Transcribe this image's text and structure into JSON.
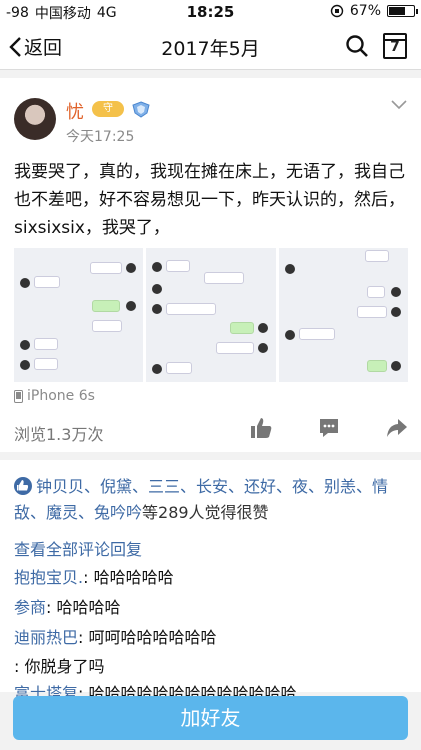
{
  "status_bar": {
    "signal": "-98",
    "carrier": "中国移动",
    "network": "4G",
    "time": "18:25",
    "battery_text": "67%",
    "battery_level": 0.67
  },
  "nav": {
    "back_label": "返回",
    "title": "2017年5月",
    "calendar_day": "7"
  },
  "post": {
    "username": "忧",
    "badge_text": "守",
    "time": "今天17:25",
    "text": "我要哭了，真的，我现在摊在床上，无语了，我自己也不差吧，好不容易想见一下，昨天认识的，然后，sixsixsix，我哭了，",
    "device": "iPhone 6s",
    "views": "浏览1.3万次"
  },
  "likes": {
    "names": "钟贝贝、倪黛、三三、长安、还好、夜、别恙、情敌、魔灵、兔吟吟",
    "suffix": "等289人觉得很赞"
  },
  "comments": {
    "see_all": "查看全部评论回复",
    "items": [
      {
        "name": "抱抱宝贝.",
        "text": ": 哈哈哈哈哈"
      },
      {
        "name": "参商",
        "text": ": 哈哈哈哈"
      },
      {
        "name": "迪丽热巴",
        "text": ": 呵呵哈哈哈哈哈哈"
      },
      {
        "name": "",
        "text": ": 你脱身了吗"
      },
      {
        "name": "富士塔复",
        "text": ": 哈哈哈哈哈哈哈哈哈哈哈哈哈"
      }
    ]
  },
  "add_friend_label": "加好友",
  "colors": {
    "accent": "#5bb6ec",
    "link": "#3e6aa5",
    "username": "#e0622a"
  }
}
